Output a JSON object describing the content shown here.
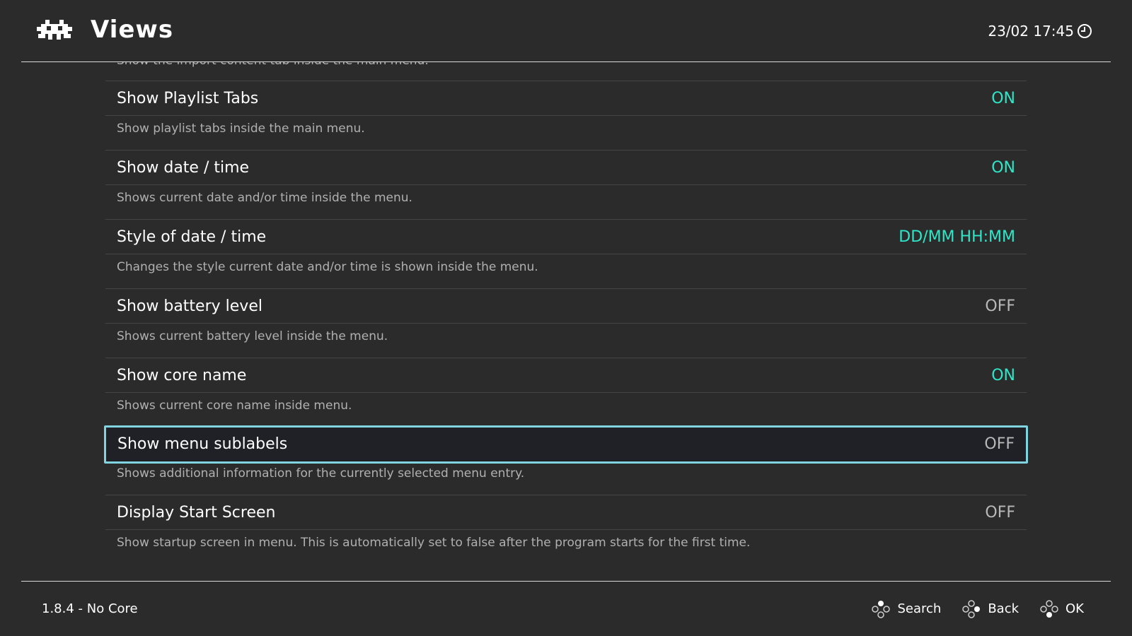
{
  "header": {
    "title": "Views",
    "clock_text": "23/02 17:45",
    "logo_icon": "retroarch-invader-icon",
    "clock_icon": "clock-icon"
  },
  "colors": {
    "background": "#2b2b2b",
    "on_value": "#2ee6c8",
    "off_value": "#b8b8b8",
    "selection_border": "#7fd4df"
  },
  "menu": {
    "partial_sublabel": "Show the import content tab inside the main menu.",
    "entries": [
      {
        "label": "Show Playlist Tabs",
        "value": "ON",
        "sublabel": "Show playlist tabs inside the main menu."
      },
      {
        "label": "Show date / time",
        "value": "ON",
        "sublabel": "Shows current date and/or time inside the menu."
      },
      {
        "label": "Style of date / time",
        "value": "DD/MM HH:MM",
        "sublabel": "Changes the style current date and/or time is shown inside the menu."
      },
      {
        "label": "Show battery level",
        "value": "OFF",
        "sublabel": "Shows current battery level inside the menu."
      },
      {
        "label": "Show core name",
        "value": "ON",
        "sublabel": "Shows current core name inside menu."
      },
      {
        "label": "Show menu sublabels",
        "value": "OFF",
        "sublabel": "Shows additional information for the currently selected menu entry.",
        "selected": true
      },
      {
        "label": "Display Start Screen",
        "value": "OFF",
        "sublabel": "Show startup screen in menu. This is automatically set to false after the program starts for the first time."
      }
    ]
  },
  "footer": {
    "version": "1.8.4 - No Core",
    "actions": [
      {
        "label": "Search",
        "icon": "gamepad-button-top-icon"
      },
      {
        "label": "Back",
        "icon": "gamepad-button-right-icon"
      },
      {
        "label": "OK",
        "icon": "gamepad-button-bottom-icon"
      }
    ]
  }
}
